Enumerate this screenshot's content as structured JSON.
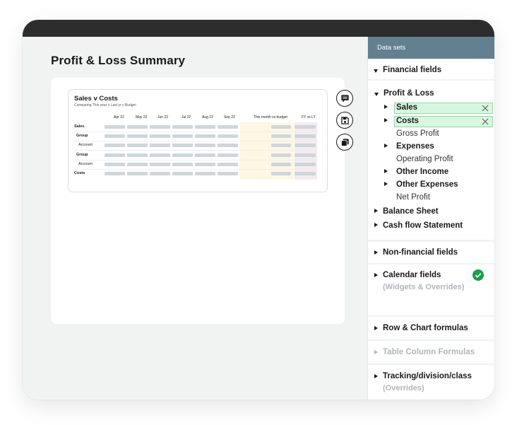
{
  "page": {
    "title": "Profit & Loss Summary"
  },
  "widget": {
    "title": "Sales v Costs",
    "subtitle": "Comparing This year v Last yr v Budget",
    "columns": [
      "Apr 22",
      "May 22",
      "Jun 22",
      "Jul 22",
      "Aug 22",
      "Sep 22",
      "This month vs budget",
      "FY vs LY"
    ],
    "rows": [
      {
        "label": "Sales",
        "bold": true
      },
      {
        "label": "Group",
        "bold": true
      },
      {
        "label": "Account",
        "bold": false
      },
      {
        "label": "Group",
        "bold": true
      },
      {
        "label": "Account",
        "bold": false
      },
      {
        "label": "Costs",
        "bold": true
      }
    ]
  },
  "toolbar": {
    "comment_icon": "comment-icon",
    "save_icon": "save-icon",
    "copy_icon": "copy-icon"
  },
  "panel": {
    "header": "Data sets",
    "financial_fields": "Financial fields",
    "profit_loss": "Profit & Loss",
    "pl_items": {
      "sales": "Sales",
      "costs": "Costs",
      "gross_profit": "Gross Profit",
      "expenses": "Expenses",
      "operating_profit": "Operating Profit",
      "other_income": "Other Income",
      "other_expenses": "Other Expenses",
      "net_profit": "Net Profit"
    },
    "balance_sheet": "Balance Sheet",
    "cash_flow": "Cash flow Statement",
    "non_financial": "Non-financial fields",
    "calendar": "Calendar fields",
    "calendar_sub": "(Widgets & Overrides)",
    "row_chart": "Row & Chart formulas",
    "table_column": "Table Column Formulas",
    "tracking": "Tracking/division/class",
    "tracking_sub": "(Overrides)"
  },
  "colors": {
    "header": "#62808f",
    "chip_bg": "#d8f7e0",
    "chip_border": "#8fd9a6",
    "check": "#17a24c"
  }
}
